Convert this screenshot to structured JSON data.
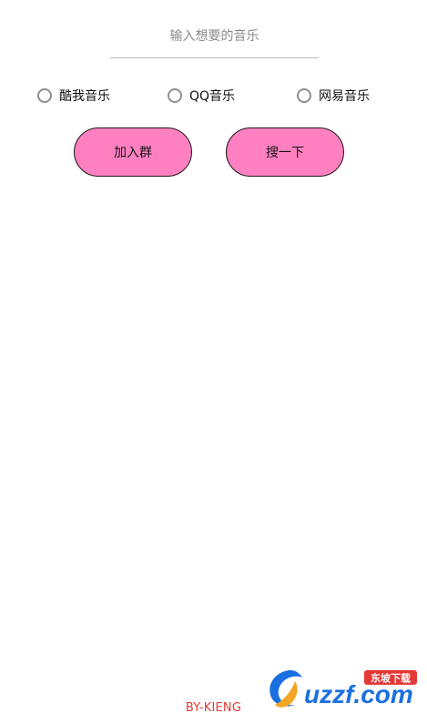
{
  "search": {
    "placeholder": "输入想要的音乐",
    "value": ""
  },
  "sources": {
    "options": [
      {
        "label": "酷我音乐",
        "selected": false
      },
      {
        "label": "QQ音乐",
        "selected": false
      },
      {
        "label": "网易音乐",
        "selected": false
      }
    ]
  },
  "actions": {
    "join_label": "加入群",
    "search_label": "搜一下"
  },
  "footer": {
    "credit": "BY-KIENG"
  },
  "watermark": {
    "brand": "uzzf.com",
    "tagline": "东坡下载"
  },
  "colors": {
    "button_fill": "#ff80c0",
    "footer_text": "#e53935",
    "watermark_blue": "#1a6fe0",
    "watermark_tag": "#e53935"
  }
}
